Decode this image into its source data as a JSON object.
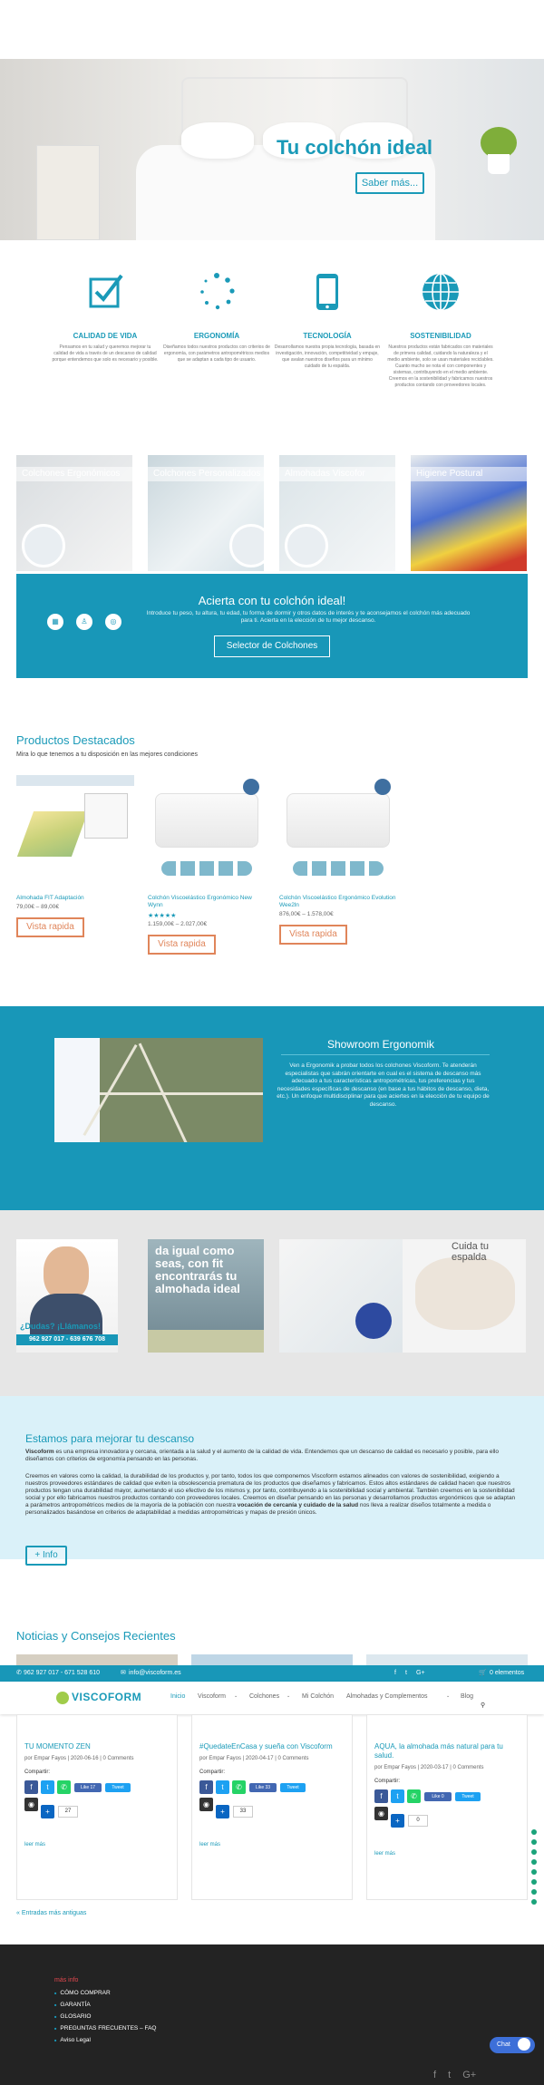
{
  "hero": {
    "title": "Tu colchón ideal",
    "button": "Saber más..."
  },
  "features": [
    {
      "icon": "checkbox-icon",
      "title": "CALIDAD DE VIDA",
      "text": "Pensamos en tu salud y queremos mejorar tu calidad de vida a través de un descanso de calidad porque entendemos que solo es necesario y posible."
    },
    {
      "icon": "loading-dots-icon",
      "title": "ERGONOMÍA",
      "text": "Diseñamos todos nuestros productos con criterios de ergonomía, con parámetros antropométricos medios que se adaptan a cada tipo de usuario."
    },
    {
      "icon": "smartphone-icon",
      "title": "TECNOLOGÍA",
      "text": "Desarrollamos nuestra propia tecnología, basada en investigación, innovación, competitividad y empuje, que avalan nuestros diseños para un mínimo cuidado de tu espalda."
    },
    {
      "icon": "globe-icon",
      "title": "SOSTENIBILIDAD",
      "text": "Nuestros productos están fabricados con materiales de primera calidad, cuidando la naturaleza y el medio ambiente, solo se usan materiales reciclables. Cuanto mucho se nota el con componentes y sistemas, contribuyendo en el medio ambiente. Creemos en la sostenibilidad y fabricamos nuestros productos contando con proveedores locales."
    }
  ],
  "categories": [
    {
      "label": "Colchones Ergonómicos"
    },
    {
      "label": "Colchones Personalizados"
    },
    {
      "label": "Almohadas Viscofor"
    },
    {
      "label": "Higiene Postural"
    }
  ],
  "selector": {
    "title": "Acierta con tu colchón ideal!",
    "text": "Introduce tu peso, tu altura, tu edad, tu forma de dormir y otros datos de interés y te aconsejamos el colchón más adecuado para ti. Acierta en la elección de tu mejor descanso.",
    "button": "Selector de Colchones"
  },
  "products_section": {
    "title": "Productos Destacados",
    "subtitle": "Mira lo que tenemos a tu disposición en las mejores condiciones"
  },
  "products": [
    {
      "name": "Almohada FIT Adaptación",
      "price": "79,00€ – 89,00€",
      "stars": "",
      "button": "Vista rapida"
    },
    {
      "name": "Colchón Viscoelástico Ergonómico New Wynn",
      "price": "1.159,00€ – 2.027,00€",
      "stars": "★★★★★",
      "button": "Vista rapida"
    },
    {
      "name": "Colchón Viscoelástico Ergonómico Evolution Wee2ln",
      "price": "876,00€ – 1.578,00€",
      "stars": "",
      "button": "Vista rapida"
    }
  ],
  "showroom": {
    "title": "Showroom Ergonomik",
    "text": "Ven a Ergonomik a probar todos los colchones Viscoform. Te atenderán especialistas que sabrán orientarte en cual es el sistema de descanso más adecuado a tus características antropométricas, tus preferencias y tus necesidades específicas de descanso (en base a tus hábitos de descanso, dieta, etc.). Un enfoque multidisciplinar para que aciertes en la elección de tu equipo de descanso."
  },
  "promos": {
    "call_text_1": "¿Dudas? ¡Llámanos!",
    "call_phones": "962 927 017 - 639 676 708",
    "fit_text": "da igual como seas, con fit encontrarás tu almohada ideal",
    "care_text": "Cuida tu espalda"
  },
  "about": {
    "title": "Estamos para mejorar tu descanso",
    "brand": "Viscoform",
    "p1": " es una empresa innovadora y cercana, orientada a la salud y el aumento de la calidad de vida. Entendemos que un descanso de calidad es necesario y posible, para ello diseñamos con criterios de ergonomía pensando en las personas.",
    "p2": "Creemos en valores como la calidad, la durabilidad de los productos y, por tanto, todos los que componemos Viscoform estamos alineados con valores de sostenibilidad, exigiendo a nuestros proveedores estándares de calidad que eviten la obsolescencia prematura de los productos que diseñamos y fabricamos. Estos altos estándares de calidad hacen que nuestros productos tengan una durabilidad mayor, aumentando el uso efectivo de los mismos y, por tanto, contribuyendo a la sostenibilidad social y ambiental. También creemos en la sostenibilidad social y por ello fabricamos nuestros productos contando con proveedores locales. Creemos en diseñar pensando en las personas y desarrollamos productos ergonómicos que se adaptan a parámetros antropométricos medios de la mayoría de la población con nuestra ",
    "p2_bold": "vocación de cercanía y cuidado de la salud",
    "p2_tail": " nos lleva a realizar diseños totalmente a medida o personalizados basándose en criterios de adaptabilidad a medidas antropométricas y mapas de presión únicos.",
    "button": "+ Info"
  },
  "news_title": "Noticias y Consejos Recientes",
  "topbar": {
    "phones": "962 927 017 - 671 528 610",
    "email": "info@viscoform.es",
    "cart": "0 elementos"
  },
  "nav": {
    "logo": "VISCOFORM",
    "items": [
      "Inicio",
      "Viscoform",
      "Colchones",
      "Mi Colchón",
      "Almohadas y Complementos",
      "Blog"
    ]
  },
  "posts": [
    {
      "title": "TU MOMENTO ZEN",
      "meta": "por Empar Fayos | 2020-06-16 | 0 Comments",
      "share": "Compartir:",
      "count": "27",
      "read_more": "leer más"
    },
    {
      "title": "#QuedateEnCasa y sueña con Viscoform",
      "meta": "por Empar Fayos | 2020-04-17 | 0 Comments",
      "share": "Compartir:",
      "count": "33",
      "read_more": "leer más"
    },
    {
      "title": "AQUA, la almohada más natural para tu salud.",
      "meta": "por Empar Fayos | 2020-03-17 | 0 Comments",
      "share": "Compartir:",
      "count": "0",
      "read_more": "leer más"
    }
  ],
  "older_entries": "« Entradas más antiguas",
  "footer": {
    "heading": "más info",
    "links": [
      "CÓMO COMPRAR",
      "GARANTÍA",
      "GLOSARIO",
      "PREGUNTAS FRECUENTES – FAQ",
      "Aviso Legal"
    ]
  },
  "chat_label": "Chat",
  "colors": {
    "teal": "#1897b8",
    "orange": "#e0855a",
    "footer": "#232323"
  }
}
